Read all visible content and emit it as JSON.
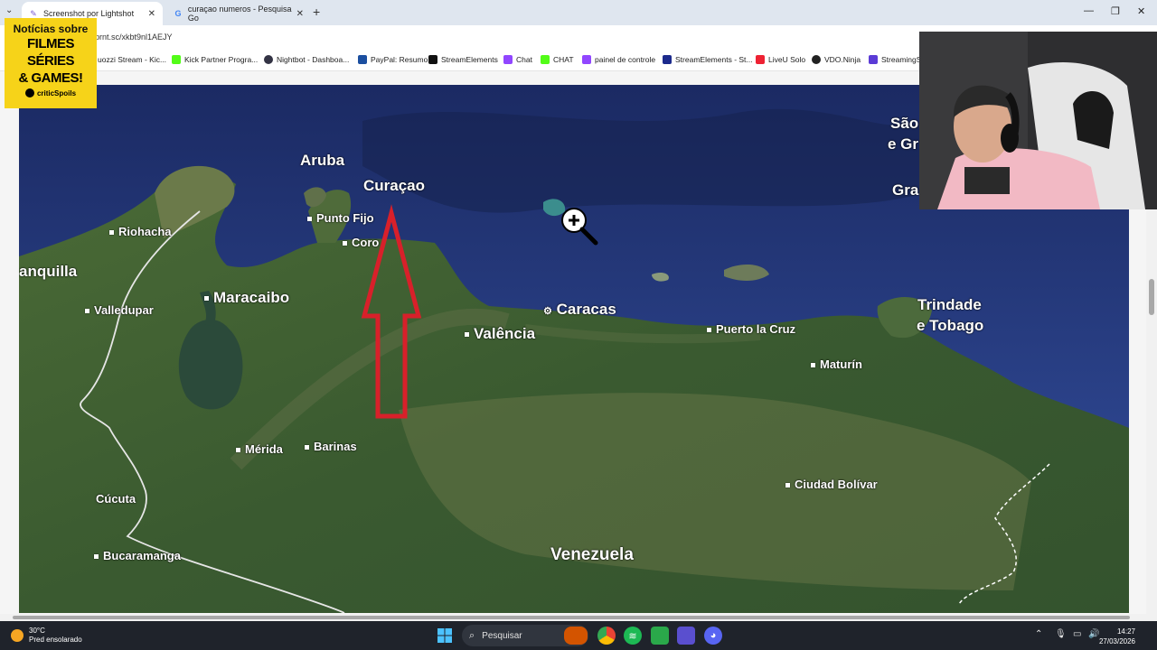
{
  "browser": {
    "tabs": [
      {
        "label": "Screenshot por Lightshot",
        "active": true
      },
      {
        "label": "curaçao numeros - Pesquisa Go",
        "active": false
      }
    ],
    "address": "prnt.sc/xkbt9nl1AEJY",
    "bookmarks": [
      "uozzi Stream - Kic...",
      "Kick Partner Progra...",
      "Nightbot - Dashboa...",
      "PayPal: Resumo",
      "StreamElements",
      "Chat",
      "CHAT",
      "painel de controle",
      "StreamElements - St...",
      "LiveU Solo",
      "VDO.Ninja",
      "StreamingS"
    ]
  },
  "map": {
    "labels": {
      "aruba": "Aruba",
      "curacao": "Curaçao",
      "punto_fijo": "Punto Fijo",
      "coro": "Coro",
      "riohacha": "Riohacha",
      "anquilla": "anquilla",
      "maracaibo": "Maracaibo",
      "valledupar": "Valledupar",
      "caracas": "Caracas",
      "valencia": "Valência",
      "puerto_la_cruz": "Puerto la Cruz",
      "trindade": "Trindade",
      "e_tobago": "e Tobago",
      "maturin": "Maturín",
      "merida": "Mérida",
      "barinas": "Barinas",
      "cucuta": "Cúcuta",
      "bucaramanga": "Bucaramanga",
      "ciudad_bolivar": "Ciudad Bolívar",
      "venezuela": "Venezuela",
      "sao": "São",
      "e_gr": "e Gr",
      "gra": "Gra"
    },
    "arrow_color": "#d8202a",
    "land_color": "#3f5d33",
    "sea_color": "#2b3f86"
  },
  "promo": {
    "line1": "Notícias sobre",
    "line2": "FILMES",
    "line3": "SÉRIES",
    "line4": "& GAMES!",
    "brand": "criticSpoils"
  },
  "taskbar": {
    "temperature": "30°C",
    "weather": "Pred ensolarado",
    "search": "Pesquisar",
    "time": "14:27",
    "date": "27/03/2026"
  }
}
